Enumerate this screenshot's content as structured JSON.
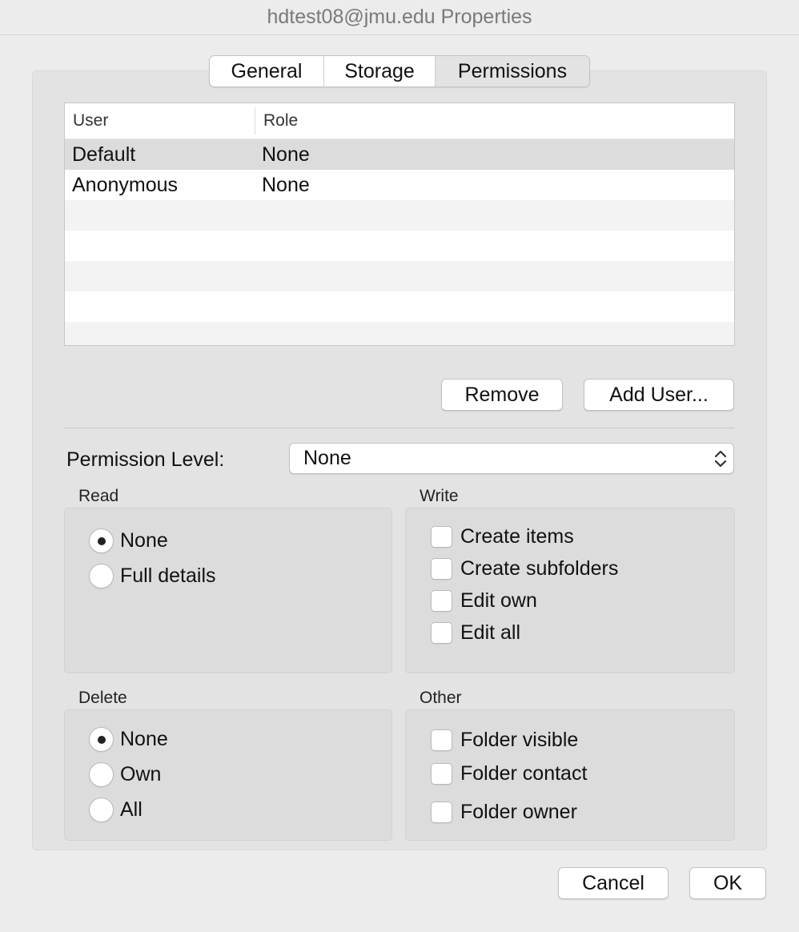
{
  "window": {
    "title": "hdtest08@jmu.edu Properties"
  },
  "tabs": [
    {
      "label": "General",
      "selected": false
    },
    {
      "label": "Storage",
      "selected": false
    },
    {
      "label": "Permissions",
      "selected": true
    }
  ],
  "table": {
    "columns": [
      "User",
      "Role"
    ],
    "rows": [
      {
        "user": "Default",
        "role": "None",
        "selected": true
      },
      {
        "user": "Anonymous",
        "role": "None",
        "selected": false
      }
    ]
  },
  "buttons": {
    "remove": "Remove",
    "add_user": "Add User...",
    "cancel": "Cancel",
    "ok": "OK"
  },
  "permission_level": {
    "label": "Permission Level:",
    "value": "None"
  },
  "read": {
    "title": "Read",
    "options": [
      "None",
      "Full details"
    ],
    "selected": "None"
  },
  "write": {
    "title": "Write",
    "options": [
      "Create items",
      "Create subfolders",
      "Edit own",
      "Edit all"
    ]
  },
  "delete": {
    "title": "Delete",
    "options": [
      "None",
      "Own",
      "All"
    ],
    "selected": "None"
  },
  "other": {
    "title": "Other",
    "options": [
      "Folder visible",
      "Folder contact",
      "Folder owner"
    ]
  }
}
